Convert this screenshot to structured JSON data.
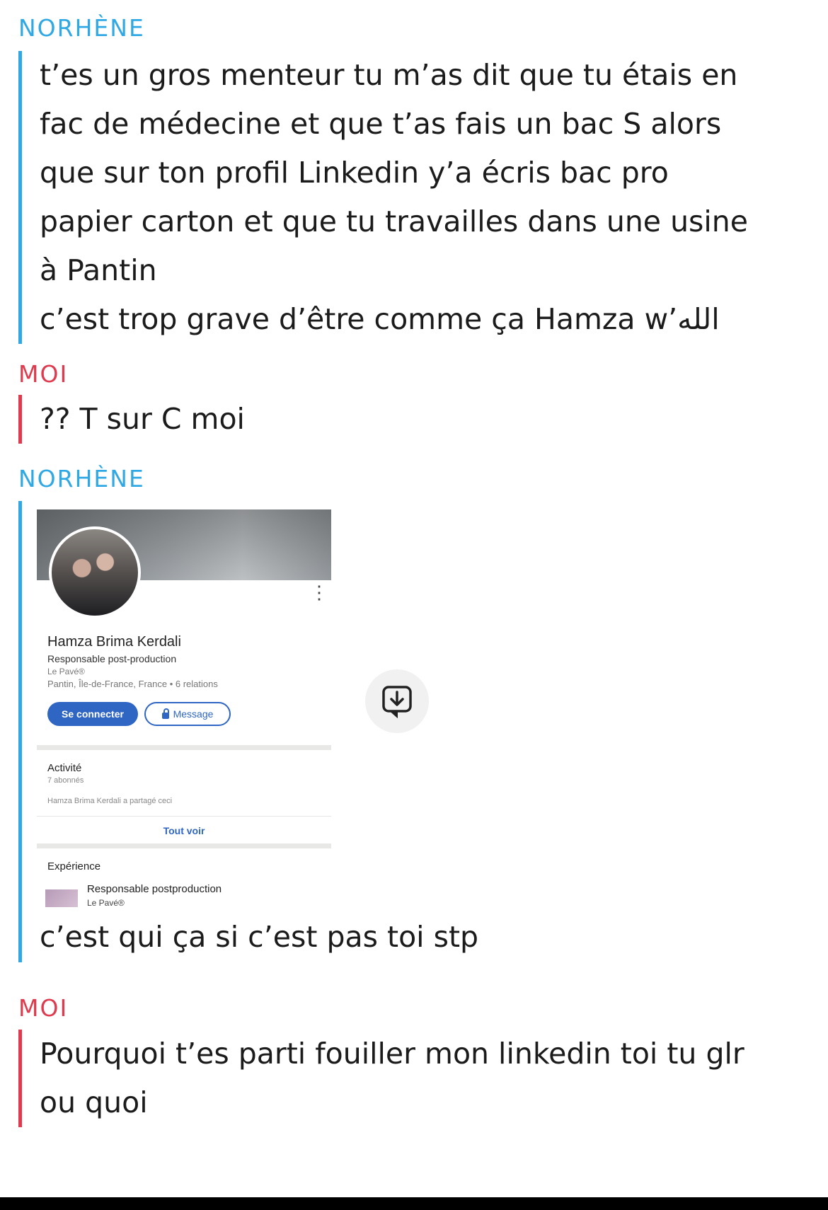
{
  "colors": {
    "them_accent": "#2fa8e3",
    "me_accent": "#e03a4e",
    "linkedin_blue": "#2f66c4"
  },
  "messages": [
    {
      "sender": "NORHÈNE",
      "lines": [
        "t’es un gros menteur tu m’as dit que tu étais en",
        "fac de médecine et que t’as fais un bac S alors",
        "que sur ton profil Linkedin y’a écris bac pro",
        "papier carton et que tu travailles dans une usine",
        "à Pantin",
        "c’est trop grave d’être comme ça Hamza w’الله"
      ]
    },
    {
      "sender": "MOI",
      "lines": [
        "?? T sur C moi"
      ]
    },
    {
      "sender": "NORHÈNE",
      "caption": "c’est qui ça si c’est pas toi stp"
    },
    {
      "sender": "MOI",
      "lines": [
        "Pourquoi t’es parti fouiller mon linkedin toi tu glr",
        "ou quoi"
      ]
    }
  ],
  "linkedin_card": {
    "name": "Hamza Brima Kerdali",
    "headline": "Responsable post-production",
    "company": "Le Pavé®",
    "location": "Pantin, Île-de-France, France • 6 relations",
    "connect_label": "Se connecter",
    "message_label": "Message",
    "activity_title": "Activité",
    "followers": "7 abonnés",
    "activity_item": "Hamza Brima Kerdali a partagé ceci",
    "see_all": "Tout voir",
    "experience_title": "Expérience",
    "experience_role": "Responsable postproduction",
    "experience_company": "Le Pavé®",
    "more_icon": "more-vertical-icon"
  },
  "save_icon": "save-download-icon"
}
